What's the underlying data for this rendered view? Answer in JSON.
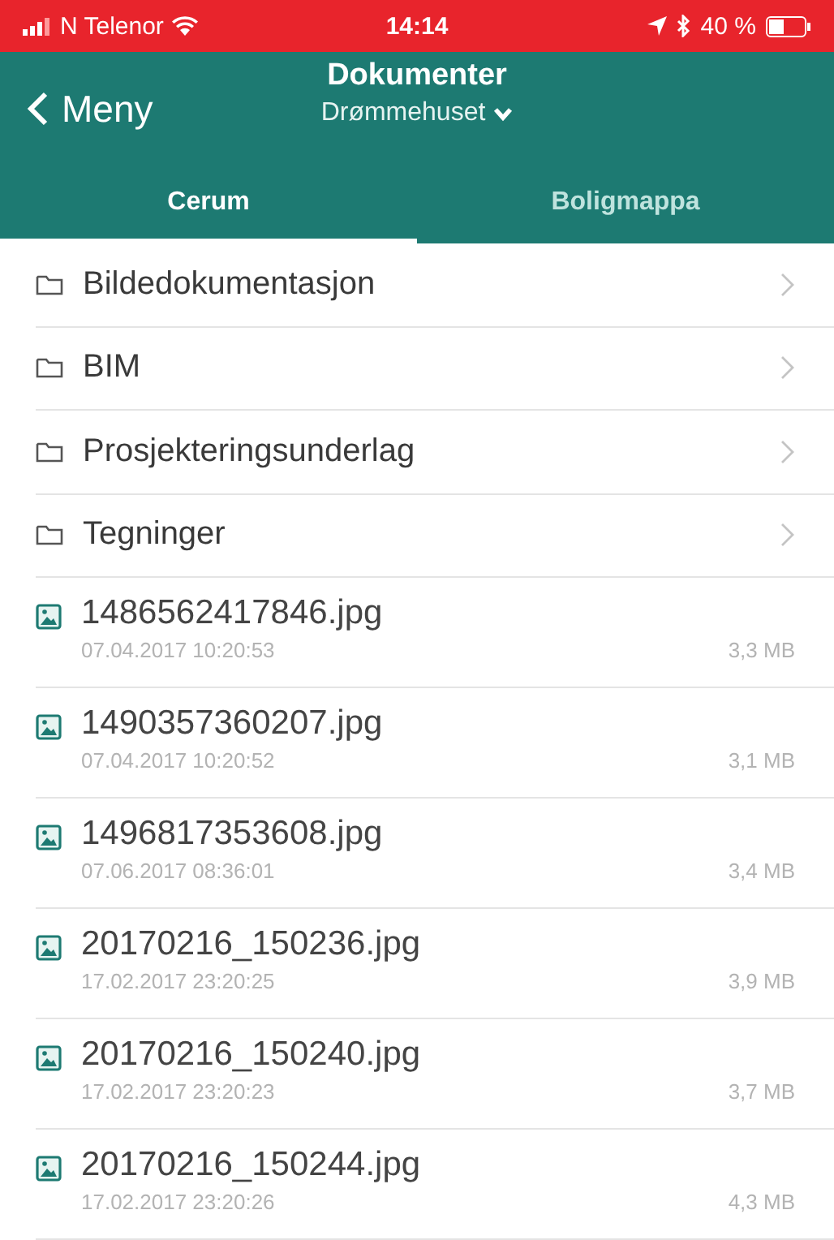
{
  "status_bar": {
    "carrier": "N Telenor",
    "time": "14:14",
    "battery": "40 %"
  },
  "header": {
    "back": "Meny",
    "title": "Dokumenter",
    "subtitle": "Drømmehuset"
  },
  "tabs": [
    {
      "label": "Cerum",
      "selected": true
    },
    {
      "label": "Boligmappa",
      "selected": false
    }
  ],
  "items": [
    {
      "kind": "folder",
      "name": "Bildedokumentasjon"
    },
    {
      "kind": "folder",
      "name": "BIM"
    },
    {
      "kind": "folder",
      "name": "Prosjekteringsunderlag"
    },
    {
      "kind": "folder",
      "name": "Tegninger"
    },
    {
      "kind": "file",
      "name": "1486562417846.jpg",
      "date": "07.04.2017 10:20:53",
      "size": "3,3 MB"
    },
    {
      "kind": "file",
      "name": "1490357360207.jpg",
      "date": "07.04.2017 10:20:52",
      "size": "3,1 MB"
    },
    {
      "kind": "file",
      "name": "1496817353608.jpg",
      "date": "07.06.2017 08:36:01",
      "size": "3,4 MB"
    },
    {
      "kind": "file",
      "name": "20170216_150236.jpg",
      "date": "17.02.2017 23:20:25",
      "size": "3,9 MB"
    },
    {
      "kind": "file",
      "name": "20170216_150240.jpg",
      "date": "17.02.2017 23:20:23",
      "size": "3,7 MB"
    },
    {
      "kind": "file",
      "name": "20170216_150244.jpg",
      "date": "17.02.2017 23:20:26",
      "size": "4,3 MB"
    }
  ]
}
